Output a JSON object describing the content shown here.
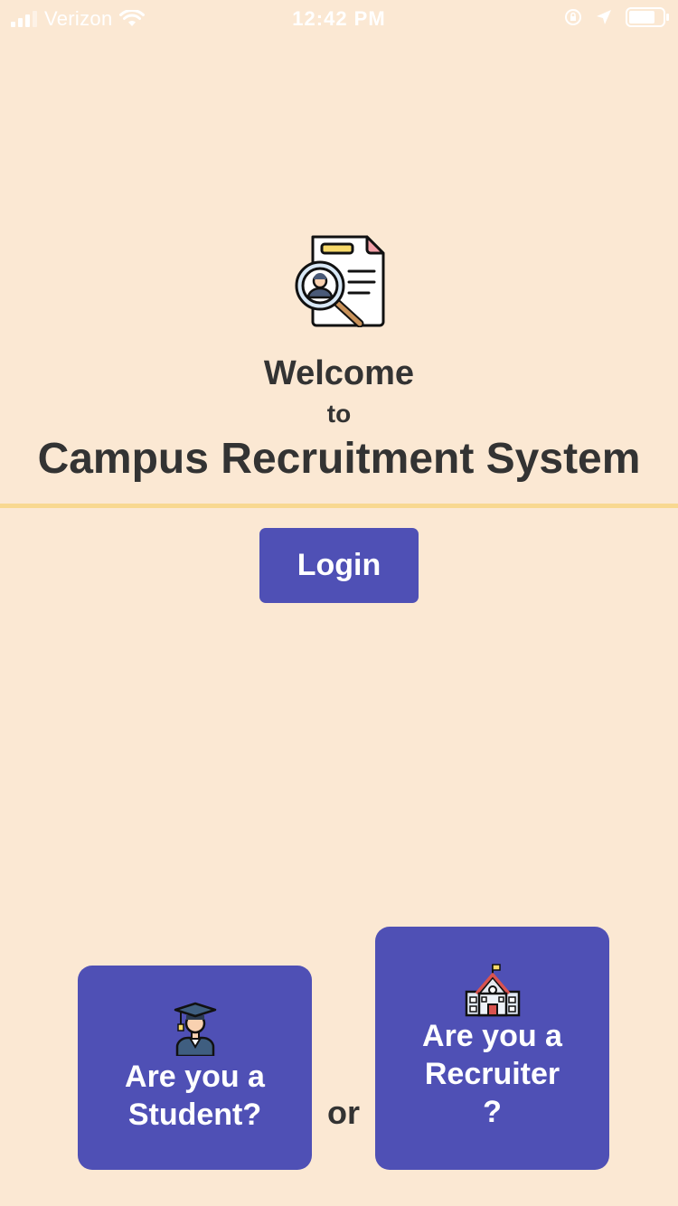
{
  "status_bar": {
    "carrier": "Verizon",
    "time": "12:42 PM"
  },
  "hero": {
    "icon": "resume-search-icon",
    "welcome": "Welcome",
    "to": "to",
    "title": "Campus Recruitment System"
  },
  "login": {
    "label": "Login"
  },
  "roles": {
    "student": {
      "icon": "graduate-icon",
      "label": "Are you a\nStudent?"
    },
    "or": "or",
    "recruiter": {
      "icon": "school-building-icon",
      "label": "Are you a\nRecruiter\n?"
    }
  },
  "colors": {
    "background": "#fbe8d3",
    "primary": "#4f50b5",
    "divider": "#f8d890",
    "text": "#333333"
  }
}
